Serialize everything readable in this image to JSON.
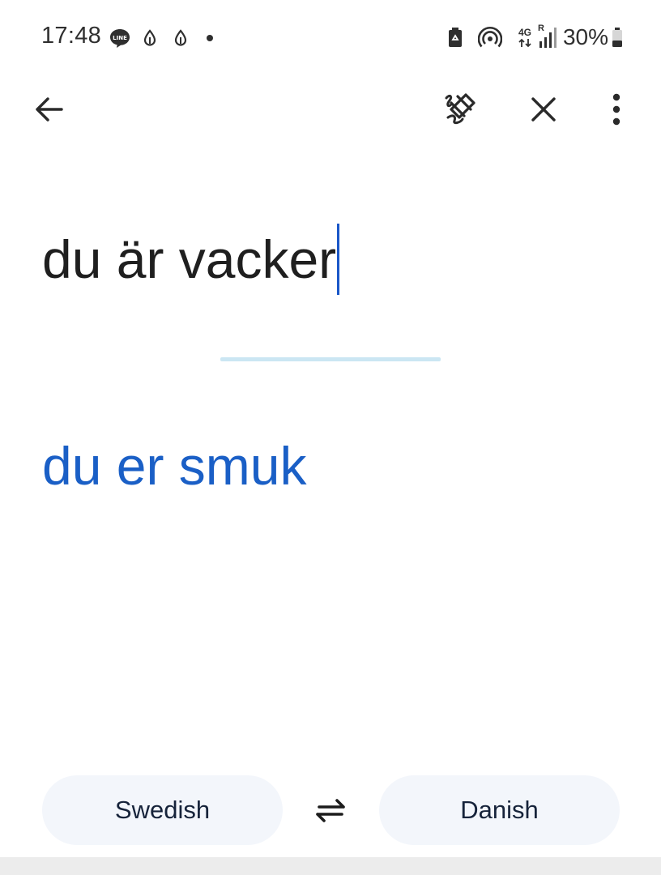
{
  "status_bar": {
    "time": "17:48",
    "battery_percent": "30%",
    "network": "4G",
    "roaming": "R",
    "icons": [
      "line-app-icon",
      "drop-icon",
      "drop-icon",
      "dot-icon",
      "battery-saver-icon",
      "hotspot-icon",
      "network-4g-icon",
      "signal-icon",
      "battery-icon"
    ]
  },
  "app_bar": {
    "icons": [
      "back-arrow-icon",
      "handwriting-icon",
      "close-icon",
      "more-vert-icon"
    ]
  },
  "input": {
    "text": "du är vacker"
  },
  "translation": {
    "text": "du er smuk"
  },
  "languages": {
    "source": "Swedish",
    "target": "Danish",
    "swap_icon": "swap-icon"
  },
  "colors": {
    "translation_text": "#1a5fc6",
    "caret": "#1a57c8",
    "divider": "#cbe6f3",
    "pill_background": "#f3f6fb"
  }
}
